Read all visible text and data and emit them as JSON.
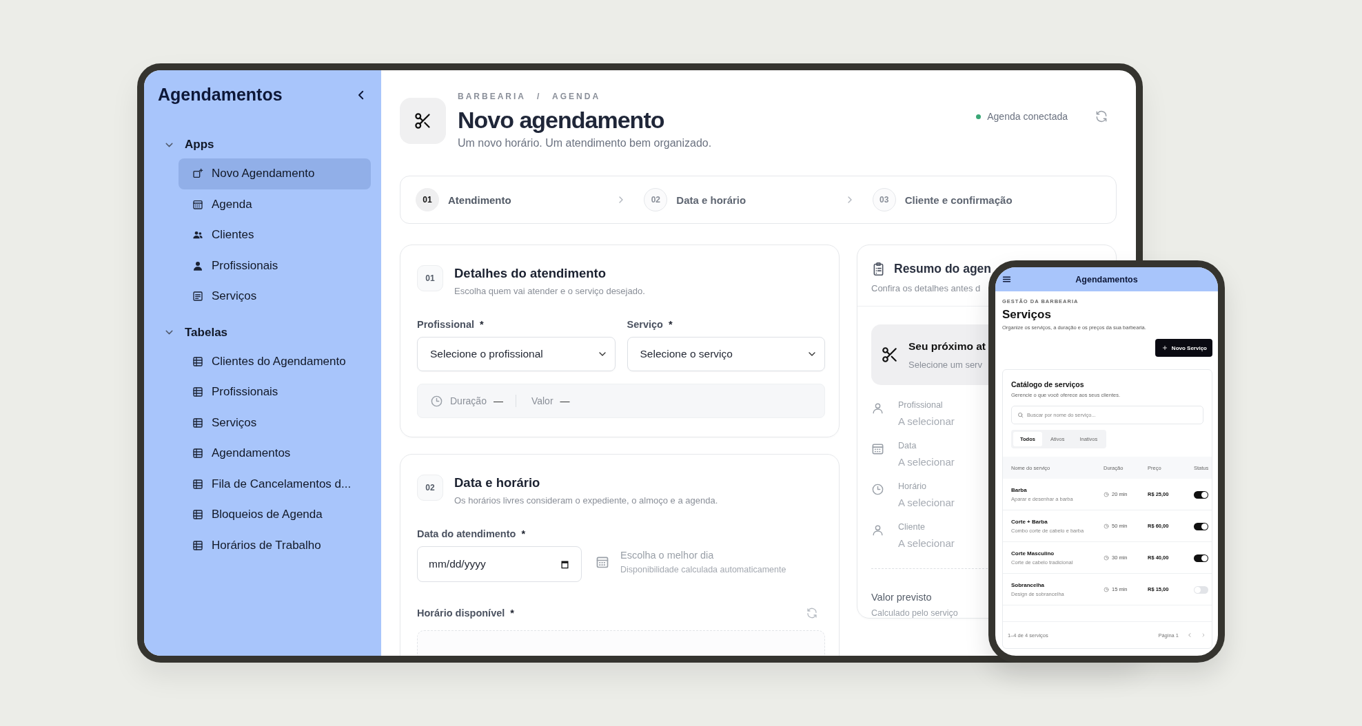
{
  "tablet": {
    "sidebar": {
      "title": "Agendamentos",
      "sections": [
        {
          "label": "Apps",
          "expanded": true,
          "items": [
            {
              "label": "Novo Agendamento",
              "selected": true
            },
            {
              "label": "Agenda",
              "selected": false
            },
            {
              "label": "Clientes",
              "selected": false
            },
            {
              "label": "Profissionais",
              "selected": false
            },
            {
              "label": "Serviços",
              "selected": false
            }
          ]
        },
        {
          "label": "Tabelas",
          "expanded": true,
          "items": [
            {
              "label": "Clientes do Agendamento",
              "selected": false
            },
            {
              "label": "Profissionais",
              "selected": false
            },
            {
              "label": "Serviços",
              "selected": false
            },
            {
              "label": "Agendamentos",
              "selected": false
            },
            {
              "label": "Fila de Cancelamentos d...",
              "selected": false
            },
            {
              "label": "Bloqueios de Agenda",
              "selected": false
            },
            {
              "label": "Horários de Trabalho",
              "selected": false
            }
          ]
        }
      ]
    },
    "header": {
      "breadcrumb": "BARBEARIA / AGENDA",
      "title": "Novo agendamento",
      "subtitle": "Um novo horário. Um atendimento bem organizado.",
      "status": {
        "label": "Agenda conectada",
        "connected": true
      }
    },
    "steps": [
      {
        "number": "01",
        "label": "Atendimento",
        "selected": true
      },
      {
        "number": "02",
        "label": "Data e horário",
        "selected": false
      },
      {
        "number": "03",
        "label": "Cliente e confirmação",
        "selected": false
      }
    ],
    "details": {
      "number": "01",
      "title": "Detalhes do atendimento",
      "subtitle": "Escolha quem vai atender e o serviço desejado.",
      "fields": [
        {
          "label": "Profissional",
          "required_mark": "*",
          "placeholder": "Selecione o profissional"
        },
        {
          "label": "Serviço",
          "required_mark": "*",
          "placeholder": "Selecione o serviço"
        }
      ],
      "info": [
        {
          "label": "Duração",
          "value": "—"
        },
        {
          "label": "Valor",
          "value": "—"
        }
      ]
    },
    "schedule": {
      "number": "02",
      "title": "Data e horário",
      "subtitle": "Os horários livres consideram o expediente, o almoço e a agenda.",
      "date_field": {
        "label": "Data do atendimento",
        "required_mark": "*",
        "placeholder": "mm/dd/yyyy"
      },
      "hint": {
        "title": "Escolha o melhor dia",
        "text": "Disponibilidade calculada automaticamente"
      },
      "slots": {
        "label": "Horário disponível",
        "required_mark": "*"
      }
    },
    "summary": {
      "title": "Resumo do agen",
      "subtitle": "Confira os detalhes antes d",
      "next": {
        "title": "Seu próximo at",
        "subtitle": "Selecione um serv"
      },
      "rows": [
        {
          "label": "Profissional",
          "value": "A selecionar"
        },
        {
          "label": "Data",
          "value": "A selecionar"
        },
        {
          "label": "Horário",
          "value": "A selecionar"
        },
        {
          "label": "Cliente",
          "value": "A selecionar"
        }
      ],
      "total": {
        "label": "Valor previsto",
        "note": "Calculado pelo serviço"
      }
    }
  },
  "phone": {
    "title": "Agendamentos",
    "eyebrow": "GESTÃO DA BARBEARIA",
    "heading": "Serviços",
    "subtitle": "Organize os serviços, a duração e os preços da sua barbearia.",
    "action": "Novo Serviço",
    "catalog": {
      "title": "Catálogo de serviços",
      "subtitle": "Gerencie o que você oferece aos seus clientes.",
      "search": {
        "placeholder": "Buscar por nome do serviço..."
      },
      "tabs": [
        {
          "label": "Todos",
          "selected": true
        },
        {
          "label": "Ativos",
          "selected": false
        },
        {
          "label": "Inativos",
          "selected": false
        }
      ],
      "columns": [
        "Nome do serviço",
        "Duração",
        "Preço",
        "Status"
      ],
      "rows": [
        {
          "name": "Barba",
          "description": "Aparar e desenhar a barba",
          "duration": "20 min",
          "price": "R$ 25,00",
          "on": true
        },
        {
          "name": "Corte + Barba",
          "description": "Combo corte de cabelo e barba",
          "duration": "50 min",
          "price": "R$ 60,00",
          "on": true
        },
        {
          "name": "Corte Masculino",
          "description": "Corte de cabelo tradicional",
          "duration": "30 min",
          "price": "R$ 40,00",
          "on": true
        },
        {
          "name": "Sobrancelha",
          "description": "Design de sobrancelha",
          "duration": "15 min",
          "price": "R$ 15,00",
          "on": false
        }
      ],
      "footer": {
        "range": "1–4 de 4 serviços",
        "page": "Página 1"
      }
    }
  }
}
